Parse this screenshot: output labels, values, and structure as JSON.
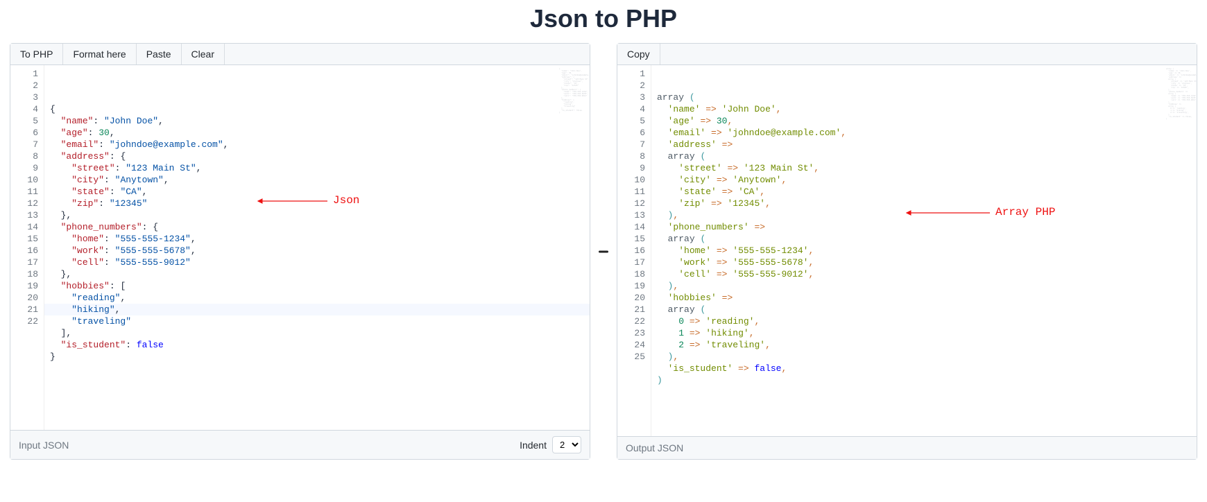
{
  "title": "Json to PHP",
  "left": {
    "buttons": {
      "to_php": "To PHP",
      "format_here": "Format here",
      "paste": "Paste",
      "clear": "Clear"
    },
    "status_label": "Input JSON",
    "indent_label": "Indent",
    "indent_value": "2",
    "highlighted_line_index": 20,
    "line_count": 22,
    "annotation_label": "Json",
    "code_lines": [
      [
        {
          "t": "brace",
          "v": "{"
        }
      ],
      [
        {
          "t": "indent",
          "v": "  "
        },
        {
          "t": "key",
          "v": "\"name\""
        },
        {
          "t": "punc",
          "v": ": "
        },
        {
          "t": "val",
          "v": "\"John Doe\""
        },
        {
          "t": "punc",
          "v": ","
        }
      ],
      [
        {
          "t": "indent",
          "v": "  "
        },
        {
          "t": "key",
          "v": "\"age\""
        },
        {
          "t": "punc",
          "v": ": "
        },
        {
          "t": "num",
          "v": "30"
        },
        {
          "t": "punc",
          "v": ","
        }
      ],
      [
        {
          "t": "indent",
          "v": "  "
        },
        {
          "t": "key",
          "v": "\"email\""
        },
        {
          "t": "punc",
          "v": ": "
        },
        {
          "t": "val",
          "v": "\"johndoe@example.com\""
        },
        {
          "t": "punc",
          "v": ","
        }
      ],
      [
        {
          "t": "indent",
          "v": "  "
        },
        {
          "t": "key",
          "v": "\"address\""
        },
        {
          "t": "punc",
          "v": ": "
        },
        {
          "t": "brace",
          "v": "{"
        }
      ],
      [
        {
          "t": "indent",
          "v": "    "
        },
        {
          "t": "key",
          "v": "\"street\""
        },
        {
          "t": "punc",
          "v": ": "
        },
        {
          "t": "val",
          "v": "\"123 Main St\""
        },
        {
          "t": "punc",
          "v": ","
        }
      ],
      [
        {
          "t": "indent",
          "v": "    "
        },
        {
          "t": "key",
          "v": "\"city\""
        },
        {
          "t": "punc",
          "v": ": "
        },
        {
          "t": "val",
          "v": "\"Anytown\""
        },
        {
          "t": "punc",
          "v": ","
        }
      ],
      [
        {
          "t": "indent",
          "v": "    "
        },
        {
          "t": "key",
          "v": "\"state\""
        },
        {
          "t": "punc",
          "v": ": "
        },
        {
          "t": "val",
          "v": "\"CA\""
        },
        {
          "t": "punc",
          "v": ","
        }
      ],
      [
        {
          "t": "indent",
          "v": "    "
        },
        {
          "t": "key",
          "v": "\"zip\""
        },
        {
          "t": "punc",
          "v": ": "
        },
        {
          "t": "val",
          "v": "\"12345\""
        }
      ],
      [
        {
          "t": "indent",
          "v": "  "
        },
        {
          "t": "brace",
          "v": "}"
        },
        {
          "t": "punc",
          "v": ","
        }
      ],
      [
        {
          "t": "indent",
          "v": "  "
        },
        {
          "t": "key",
          "v": "\"phone_numbers\""
        },
        {
          "t": "punc",
          "v": ": "
        },
        {
          "t": "brace",
          "v": "{"
        }
      ],
      [
        {
          "t": "indent",
          "v": "    "
        },
        {
          "t": "key",
          "v": "\"home\""
        },
        {
          "t": "punc",
          "v": ": "
        },
        {
          "t": "val",
          "v": "\"555-555-1234\""
        },
        {
          "t": "punc",
          "v": ","
        }
      ],
      [
        {
          "t": "indent",
          "v": "    "
        },
        {
          "t": "key",
          "v": "\"work\""
        },
        {
          "t": "punc",
          "v": ": "
        },
        {
          "t": "val",
          "v": "\"555-555-5678\""
        },
        {
          "t": "punc",
          "v": ","
        }
      ],
      [
        {
          "t": "indent",
          "v": "    "
        },
        {
          "t": "key",
          "v": "\"cell\""
        },
        {
          "t": "punc",
          "v": ": "
        },
        {
          "t": "val",
          "v": "\"555-555-9012\""
        }
      ],
      [
        {
          "t": "indent",
          "v": "  "
        },
        {
          "t": "brace",
          "v": "}"
        },
        {
          "t": "punc",
          "v": ","
        }
      ],
      [
        {
          "t": "indent",
          "v": "  "
        },
        {
          "t": "key",
          "v": "\"hobbies\""
        },
        {
          "t": "punc",
          "v": ": "
        },
        {
          "t": "brace",
          "v": "["
        }
      ],
      [
        {
          "t": "indent",
          "v": "    "
        },
        {
          "t": "val",
          "v": "\"reading\""
        },
        {
          "t": "punc",
          "v": ","
        }
      ],
      [
        {
          "t": "indent",
          "v": "    "
        },
        {
          "t": "val",
          "v": "\"hiking\""
        },
        {
          "t": "punc",
          "v": ","
        }
      ],
      [
        {
          "t": "indent",
          "v": "    "
        },
        {
          "t": "val",
          "v": "\"traveling\""
        }
      ],
      [
        {
          "t": "indent",
          "v": "  "
        },
        {
          "t": "brace",
          "v": "]"
        },
        {
          "t": "punc",
          "v": ","
        }
      ],
      [
        {
          "t": "indent",
          "v": "  "
        },
        {
          "t": "key",
          "v": "\"is_student\""
        },
        {
          "t": "punc",
          "v": ": "
        },
        {
          "t": "bool",
          "v": "false"
        }
      ],
      [
        {
          "t": "brace",
          "v": "}"
        }
      ]
    ]
  },
  "right": {
    "buttons": {
      "copy": "Copy"
    },
    "status_label": "Output JSON",
    "line_count": 25,
    "annotation_label": "Array PHP",
    "code_lines": [
      [
        {
          "t": "kw",
          "v": "array"
        },
        {
          "t": "sp",
          "v": " "
        },
        {
          "t": "paren",
          "v": "("
        }
      ],
      [
        {
          "t": "indent",
          "v": "  "
        },
        {
          "t": "str",
          "v": "'name'"
        },
        {
          "t": "sp",
          "v": " "
        },
        {
          "t": "op",
          "v": "=>"
        },
        {
          "t": "sp",
          "v": " "
        },
        {
          "t": "str",
          "v": "'John Doe'"
        },
        {
          "t": "punc",
          "v": ","
        }
      ],
      [
        {
          "t": "indent",
          "v": "  "
        },
        {
          "t": "str",
          "v": "'age'"
        },
        {
          "t": "sp",
          "v": " "
        },
        {
          "t": "op",
          "v": "=>"
        },
        {
          "t": "sp",
          "v": " "
        },
        {
          "t": "num",
          "v": "30"
        },
        {
          "t": "punc",
          "v": ","
        }
      ],
      [
        {
          "t": "indent",
          "v": "  "
        },
        {
          "t": "str",
          "v": "'email'"
        },
        {
          "t": "sp",
          "v": " "
        },
        {
          "t": "op",
          "v": "=>"
        },
        {
          "t": "sp",
          "v": " "
        },
        {
          "t": "str",
          "v": "'johndoe@example.com'"
        },
        {
          "t": "punc",
          "v": ","
        }
      ],
      [
        {
          "t": "indent",
          "v": "  "
        },
        {
          "t": "str",
          "v": "'address'"
        },
        {
          "t": "sp",
          "v": " "
        },
        {
          "t": "op",
          "v": "=>"
        }
      ],
      [
        {
          "t": "indent",
          "v": "  "
        },
        {
          "t": "kw",
          "v": "array"
        },
        {
          "t": "sp",
          "v": " "
        },
        {
          "t": "paren",
          "v": "("
        }
      ],
      [
        {
          "t": "indent",
          "v": "    "
        },
        {
          "t": "str",
          "v": "'street'"
        },
        {
          "t": "sp",
          "v": " "
        },
        {
          "t": "op",
          "v": "=>"
        },
        {
          "t": "sp",
          "v": " "
        },
        {
          "t": "str",
          "v": "'123 Main St'"
        },
        {
          "t": "punc",
          "v": ","
        }
      ],
      [
        {
          "t": "indent",
          "v": "    "
        },
        {
          "t": "str",
          "v": "'city'"
        },
        {
          "t": "sp",
          "v": " "
        },
        {
          "t": "op",
          "v": "=>"
        },
        {
          "t": "sp",
          "v": " "
        },
        {
          "t": "str",
          "v": "'Anytown'"
        },
        {
          "t": "punc",
          "v": ","
        }
      ],
      [
        {
          "t": "indent",
          "v": "    "
        },
        {
          "t": "str",
          "v": "'state'"
        },
        {
          "t": "sp",
          "v": " "
        },
        {
          "t": "op",
          "v": "=>"
        },
        {
          "t": "sp",
          "v": " "
        },
        {
          "t": "str",
          "v": "'CA'"
        },
        {
          "t": "punc",
          "v": ","
        }
      ],
      [
        {
          "t": "indent",
          "v": "    "
        },
        {
          "t": "str",
          "v": "'zip'"
        },
        {
          "t": "sp",
          "v": " "
        },
        {
          "t": "op",
          "v": "=>"
        },
        {
          "t": "sp",
          "v": " "
        },
        {
          "t": "str",
          "v": "'12345'"
        },
        {
          "t": "punc",
          "v": ","
        }
      ],
      [
        {
          "t": "indent",
          "v": "  "
        },
        {
          "t": "paren",
          "v": ")"
        },
        {
          "t": "punc",
          "v": ","
        }
      ],
      [
        {
          "t": "indent",
          "v": "  "
        },
        {
          "t": "str",
          "v": "'phone_numbers'"
        },
        {
          "t": "sp",
          "v": " "
        },
        {
          "t": "op",
          "v": "=>"
        }
      ],
      [
        {
          "t": "indent",
          "v": "  "
        },
        {
          "t": "kw",
          "v": "array"
        },
        {
          "t": "sp",
          "v": " "
        },
        {
          "t": "paren",
          "v": "("
        }
      ],
      [
        {
          "t": "indent",
          "v": "    "
        },
        {
          "t": "str",
          "v": "'home'"
        },
        {
          "t": "sp",
          "v": " "
        },
        {
          "t": "op",
          "v": "=>"
        },
        {
          "t": "sp",
          "v": " "
        },
        {
          "t": "str",
          "v": "'555-555-1234'"
        },
        {
          "t": "punc",
          "v": ","
        }
      ],
      [
        {
          "t": "indent",
          "v": "    "
        },
        {
          "t": "str",
          "v": "'work'"
        },
        {
          "t": "sp",
          "v": " "
        },
        {
          "t": "op",
          "v": "=>"
        },
        {
          "t": "sp",
          "v": " "
        },
        {
          "t": "str",
          "v": "'555-555-5678'"
        },
        {
          "t": "punc",
          "v": ","
        }
      ],
      [
        {
          "t": "indent",
          "v": "    "
        },
        {
          "t": "str",
          "v": "'cell'"
        },
        {
          "t": "sp",
          "v": " "
        },
        {
          "t": "op",
          "v": "=>"
        },
        {
          "t": "sp",
          "v": " "
        },
        {
          "t": "str",
          "v": "'555-555-9012'"
        },
        {
          "t": "punc",
          "v": ","
        }
      ],
      [
        {
          "t": "indent",
          "v": "  "
        },
        {
          "t": "paren",
          "v": ")"
        },
        {
          "t": "punc",
          "v": ","
        }
      ],
      [
        {
          "t": "indent",
          "v": "  "
        },
        {
          "t": "str",
          "v": "'hobbies'"
        },
        {
          "t": "sp",
          "v": " "
        },
        {
          "t": "op",
          "v": "=>"
        }
      ],
      [
        {
          "t": "indent",
          "v": "  "
        },
        {
          "t": "kw",
          "v": "array"
        },
        {
          "t": "sp",
          "v": " "
        },
        {
          "t": "paren",
          "v": "("
        }
      ],
      [
        {
          "t": "indent",
          "v": "    "
        },
        {
          "t": "num",
          "v": "0"
        },
        {
          "t": "sp",
          "v": " "
        },
        {
          "t": "op",
          "v": "=>"
        },
        {
          "t": "sp",
          "v": " "
        },
        {
          "t": "str",
          "v": "'reading'"
        },
        {
          "t": "punc",
          "v": ","
        }
      ],
      [
        {
          "t": "indent",
          "v": "    "
        },
        {
          "t": "num",
          "v": "1"
        },
        {
          "t": "sp",
          "v": " "
        },
        {
          "t": "op",
          "v": "=>"
        },
        {
          "t": "sp",
          "v": " "
        },
        {
          "t": "str",
          "v": "'hiking'"
        },
        {
          "t": "punc",
          "v": ","
        }
      ],
      [
        {
          "t": "indent",
          "v": "    "
        },
        {
          "t": "num",
          "v": "2"
        },
        {
          "t": "sp",
          "v": " "
        },
        {
          "t": "op",
          "v": "=>"
        },
        {
          "t": "sp",
          "v": " "
        },
        {
          "t": "str",
          "v": "'traveling'"
        },
        {
          "t": "punc",
          "v": ","
        }
      ],
      [
        {
          "t": "indent",
          "v": "  "
        },
        {
          "t": "paren",
          "v": ")"
        },
        {
          "t": "punc",
          "v": ","
        }
      ],
      [
        {
          "t": "indent",
          "v": "  "
        },
        {
          "t": "str",
          "v": "'is_student'"
        },
        {
          "t": "sp",
          "v": " "
        },
        {
          "t": "op",
          "v": "=>"
        },
        {
          "t": "sp",
          "v": " "
        },
        {
          "t": "bool",
          "v": "false"
        },
        {
          "t": "punc",
          "v": ","
        }
      ],
      [
        {
          "t": "paren",
          "v": ")"
        }
      ]
    ]
  }
}
